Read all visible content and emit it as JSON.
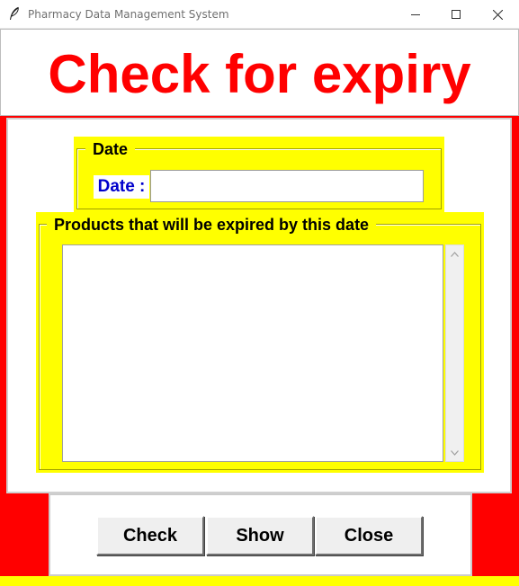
{
  "window": {
    "title": "Pharmacy Data Management System",
    "icon": "feather-icon",
    "controls": [
      "minimize-icon",
      "maximize-icon",
      "close-icon"
    ]
  },
  "header": {
    "title": "Check for expiry"
  },
  "date_frame": {
    "label": "Date",
    "field_label": "Date :",
    "field_value": ""
  },
  "products_frame": {
    "label": "Products that will be expired by this date",
    "items": []
  },
  "buttons": {
    "check": "Check",
    "show": "Show",
    "close": "Close"
  },
  "colors": {
    "background": "#ff0000",
    "frame": "#ffff00",
    "title_text": "#ff0000",
    "date_label_text": "#0000cc"
  }
}
